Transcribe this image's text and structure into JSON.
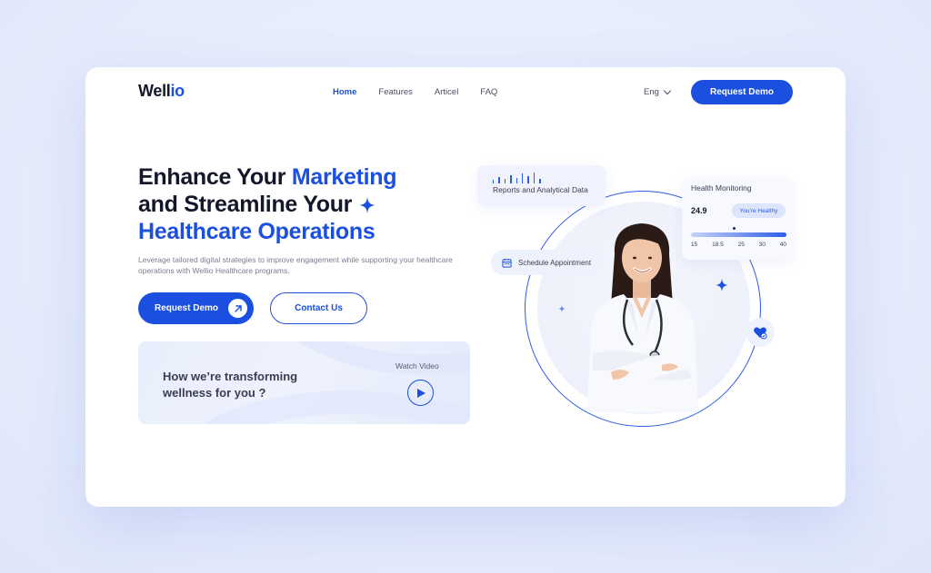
{
  "brand": {
    "logo_main": "Well",
    "logo_accent": "io"
  },
  "nav": {
    "items": [
      "Home",
      "Features",
      "Articel",
      "FAQ"
    ],
    "active": "Home"
  },
  "header": {
    "lang": "Eng",
    "cta": "Request Demo"
  },
  "hero": {
    "title_line1_plain": "Enhance Your ",
    "title_line1_accent": "Marketing",
    "title_line2": "and Streamline Your",
    "title_line3": "Healthcare Operations",
    "description": "Leverage tailored digital strategies to improve engagement while supporting your healthcare operations with  Wellio Healthcare programs.",
    "primary_cta": "Request Demo",
    "secondary_cta": "Contact Us"
  },
  "video": {
    "text_line1": "How we’re transforming",
    "text_line2": "wellness for you ?",
    "watch_label": "Watch Video"
  },
  "cards": {
    "reports": "Reports and Analytical Data",
    "schedule": "Schedule Appointment",
    "health": {
      "title": "Health Monitoring",
      "value": "24.9",
      "status": "You're Healthy",
      "scale": [
        "15",
        "18.5",
        "25",
        "30",
        "40"
      ]
    }
  },
  "colors": {
    "accent": "#1a4fe0",
    "text": "#14162b",
    "muted": "#7a7d92"
  },
  "icons": [
    "arrow-up-right-icon",
    "play-icon",
    "calendar-icon",
    "heart-icon",
    "sparkle-icon",
    "chevron-down-icon"
  ]
}
